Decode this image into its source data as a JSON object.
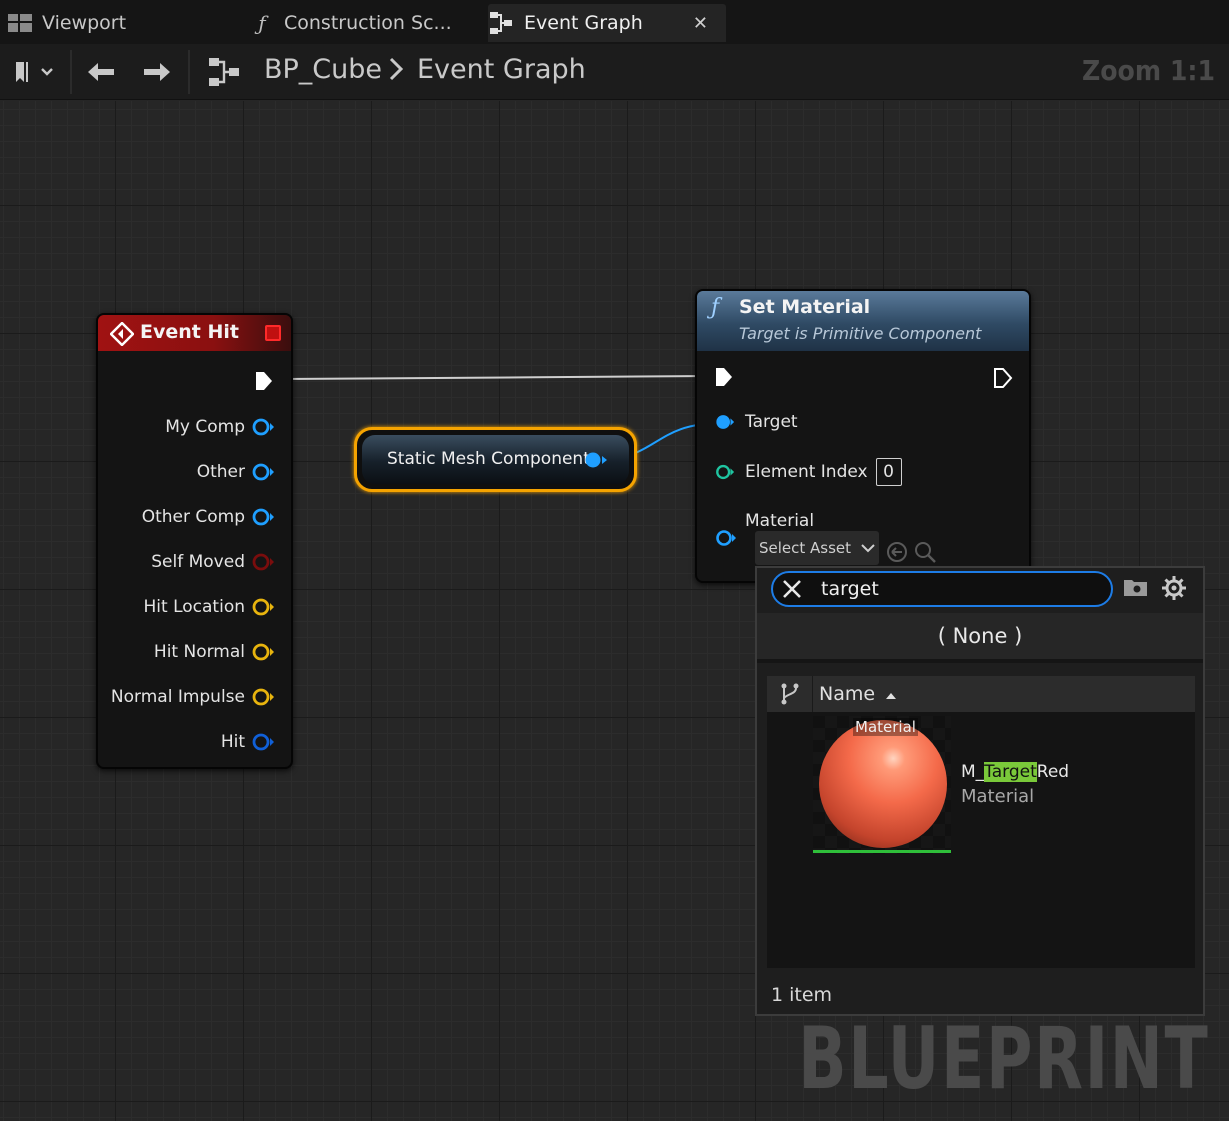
{
  "tabs": [
    {
      "label": "Viewport",
      "icon": "viewport-icon"
    },
    {
      "label": "Construction Sc...",
      "icon": "function-icon"
    },
    {
      "label": "Event Graph",
      "icon": "graph-icon",
      "active": true
    }
  ],
  "toolbar": {
    "breadcrumb_root": "BP_Cube",
    "breadcrumb_leaf": "Event Graph",
    "zoom": "Zoom 1:1"
  },
  "event_hit": {
    "title": "Event Hit",
    "pins": [
      {
        "label": "My Comp",
        "color": "#1f9fff"
      },
      {
        "label": "Other",
        "color": "#1f9fff"
      },
      {
        "label": "Other Comp",
        "color": "#1f9fff"
      },
      {
        "label": "Self Moved",
        "color": "#7a0d0d"
      },
      {
        "label": "Hit Location",
        "color": "#e8b40e"
      },
      {
        "label": "Hit Normal",
        "color": "#e8b40e"
      },
      {
        "label": "Normal Impulse",
        "color": "#e8b40e"
      },
      {
        "label": "Hit",
        "color": "#1060d8"
      }
    ]
  },
  "static_mesh": {
    "label": "Static Mesh Component"
  },
  "set_material": {
    "title": "Set Material",
    "subtitle": "Target is Primitive Component",
    "target_label": "Target",
    "element_index_label": "Element Index",
    "element_index_value": "0",
    "material_label": "Material",
    "select_asset": "Select Asset"
  },
  "picker": {
    "search_value": "target",
    "none_label": "( None )",
    "column_name": "Name",
    "asset": {
      "thumb_tag": "Material",
      "name_prefix": "M_",
      "name_match": "Target",
      "name_suffix": "Red",
      "type": "Material"
    },
    "item_count": "1 item"
  },
  "watermark": "BLUEPRINT",
  "colors": {
    "accent_blue": "#1d7ce6",
    "object_pin": "#1f9fff",
    "vector_pin": "#e8b40e",
    "highlight": "#7ac93a",
    "event_header": "#a01212",
    "function_header": "#3b5a78"
  }
}
